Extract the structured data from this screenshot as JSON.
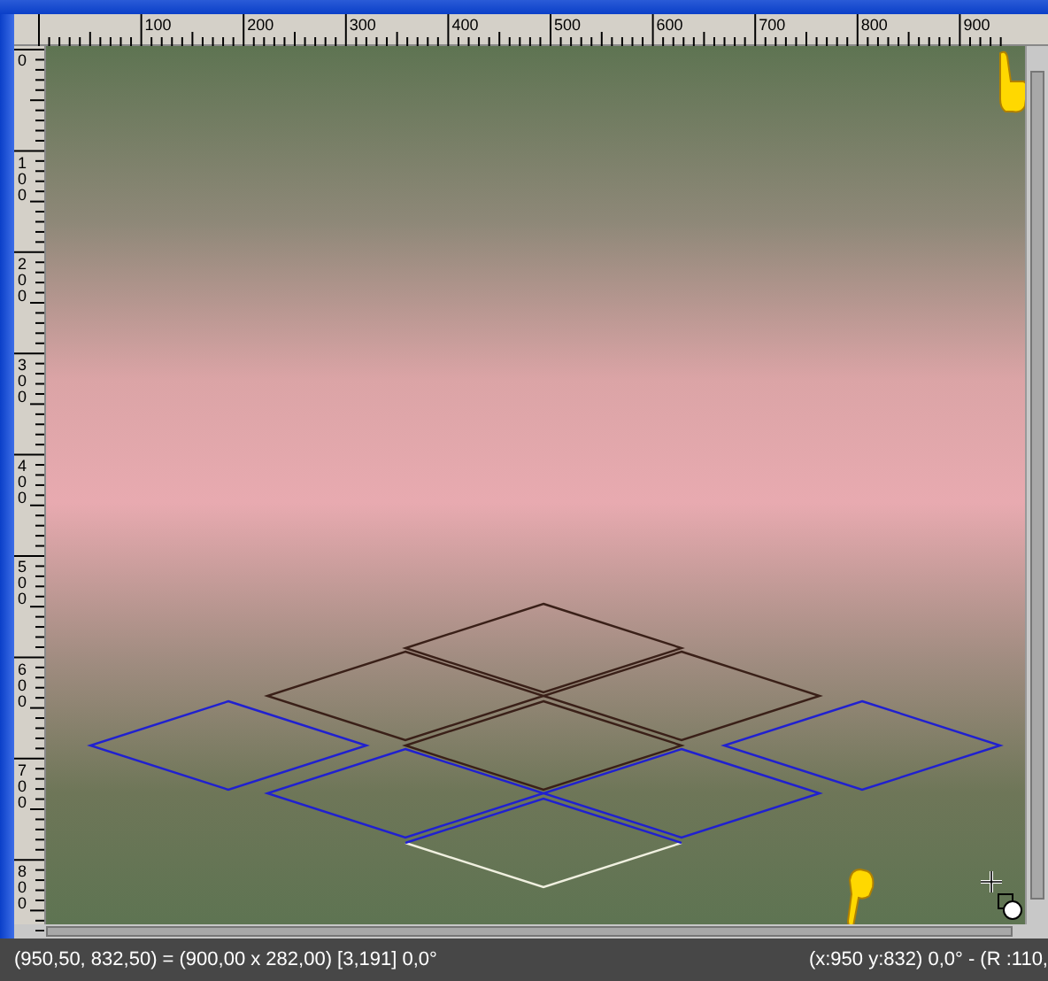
{
  "ruler_top": {
    "labels": [
      "100",
      "200",
      "300",
      "400",
      "500",
      "600",
      "700",
      "800",
      "900"
    ]
  },
  "ruler_left": {
    "labels": [
      "0",
      "100",
      "200",
      "300",
      "400",
      "500",
      "600",
      "700",
      "800"
    ]
  },
  "status_bar": {
    "left": "(950,50, 832,50) = (900,00 x 282,00) [3,191]  0,0°",
    "right": "(x:950 y:832) 0,0° - (R :110,"
  }
}
